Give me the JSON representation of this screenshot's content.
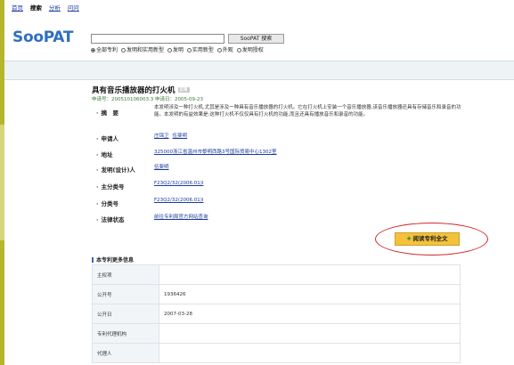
{
  "nav": {
    "items": [
      {
        "label": "首页",
        "current": false
      },
      {
        "label": "搜索",
        "current": true
      },
      {
        "label": "分析",
        "current": false
      },
      {
        "label": "问问",
        "current": false
      }
    ]
  },
  "brand": {
    "logo": "SooPAT",
    "logo_color": "#2e6fbf"
  },
  "search": {
    "value": "",
    "button_label": "SooPAT 搜索",
    "options": [
      {
        "label": "全部专利",
        "checked": true
      },
      {
        "label": "发明和实用新型",
        "checked": false
      },
      {
        "label": "发明",
        "checked": false
      },
      {
        "label": "实用新型",
        "checked": false
      },
      {
        "label": "外观",
        "checked": false
      },
      {
        "label": "发明授权",
        "checked": false
      }
    ]
  },
  "patent": {
    "title": "具有音乐播放器的打火机",
    "badge": "实审",
    "subline": "申请号：200510106003.3  申请日：2005-09-23",
    "abstract_label": "摘　要",
    "abstract_text": "本发明涉及一种打火机,尤其是涉及一种具有音乐播放器的打火机。它在打火机上安装一个音乐播放器,该音乐播放器还具有存储音乐和录音的功能。本发明的有益效果是:这种打火机不仅仅具有打火机的功能,而且还具有播放音乐和录音的功能。",
    "fields": [
      {
        "label": "申请人",
        "links": [
          "庄锦卫",
          "伍斐明"
        ]
      },
      {
        "label": "地址",
        "links": [
          "325000浙江省温州市黎明西路3号国际贸易中心1302室"
        ]
      },
      {
        "label": "发明(设计)人",
        "links": [
          "伍斐明"
        ]
      },
      {
        "label": "主分类号",
        "links": [
          "F23Q2/32(2006.01)I"
        ]
      },
      {
        "label": "分类号",
        "links": [
          "F23Q2/32(2006.01)I"
        ]
      },
      {
        "label": "法律状态",
        "links": [
          "前往专利局官方网站查询"
        ]
      }
    ],
    "read_button": "阅读专利全文",
    "highlight_color": "#d3272d"
  },
  "more_info": {
    "heading": "本专利更多信息",
    "rows": [
      {
        "key": "主权项",
        "value": ""
      },
      {
        "key": "公开号",
        "value": "1936426"
      },
      {
        "key": "公开日",
        "value": "2007-03-28"
      },
      {
        "key": "专利代理机构",
        "value": ""
      },
      {
        "key": "代理人",
        "value": ""
      }
    ]
  }
}
